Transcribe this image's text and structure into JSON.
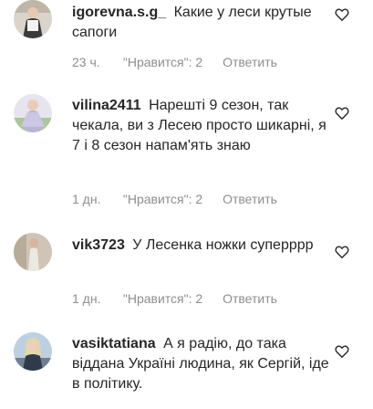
{
  "comments": [
    {
      "username": "igorevna.s.g_",
      "text": "Какие у леси крутые сапоги",
      "time": "23 ч.",
      "likes": "\"Нравится\": 2",
      "reply": "Ответить",
      "avatar_icon": "user-avatar-icon",
      "like_icon": "heart-outline-icon"
    },
    {
      "username": "vilina2411",
      "text": "Нарешті 9 сезон, так чекала, ви з Лесею просто шикарні, я 7 і 8 сезон напам'ять знаю",
      "time": "1 дн.",
      "likes": "\"Нравится\": 2",
      "reply": "Ответить",
      "avatar_icon": "user-avatar-icon",
      "like_icon": "heart-outline-icon"
    },
    {
      "username": "vik3723",
      "text": "У Лесенка ножки суперррр",
      "time": "1 дн.",
      "likes": "\"Нравится\": 2",
      "reply": "Ответить",
      "avatar_icon": "user-avatar-icon",
      "like_icon": "heart-outline-icon"
    },
    {
      "username": "vasiktatiana",
      "text": "А я радію, до така віддана Україні людина, як Сергій, іде в політику.",
      "time": "",
      "likes": "",
      "reply": "",
      "avatar_icon": "user-avatar-icon",
      "like_icon": "heart-outline-icon"
    }
  ],
  "colors": {
    "text": "#262626",
    "meta": "#8e8e8e",
    "background": "#ffffff"
  }
}
